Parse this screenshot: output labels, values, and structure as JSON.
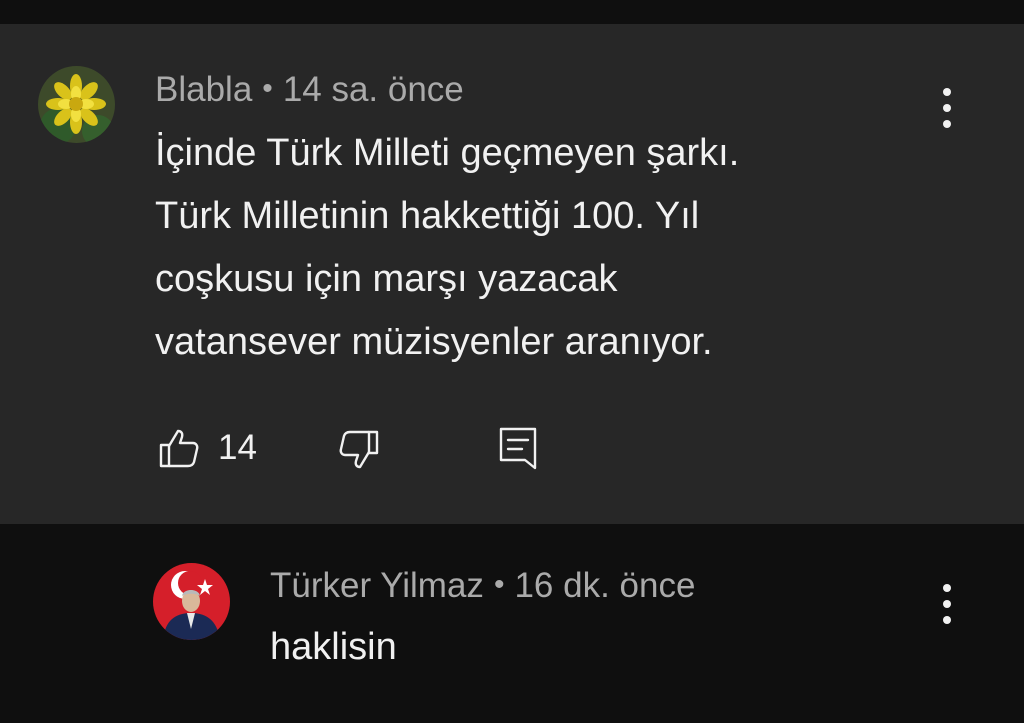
{
  "comment": {
    "author": "Blabla",
    "separator": "•",
    "time": "14 sa. önce",
    "text": "İçinde Türk Milleti geçmeyen şarkı.\nTürk Milletinin hakkettiği 100. Yıl\ncoşkusu için marşı yazacak\nvatansever müzisyenler aranıyor.",
    "like_count": "14",
    "icons": {
      "avatar": "yellow-flower-avatar",
      "menu": "more-vert-icon",
      "like": "thumbs-up-icon",
      "dislike": "thumbs-down-icon",
      "reply": "reply-comment-icon"
    }
  },
  "reply": {
    "author": "Türker Yilmaz",
    "separator": "•",
    "time": "16 dk. önce",
    "text": "haklisin",
    "icons": {
      "avatar": "flag-portrait-avatar",
      "menu": "more-vert-icon"
    }
  },
  "colors": {
    "card_background": "#272727",
    "page_background": "#0f0f0f",
    "primary_text": "#f1f1f1",
    "secondary_text": "#aaaaaa"
  }
}
